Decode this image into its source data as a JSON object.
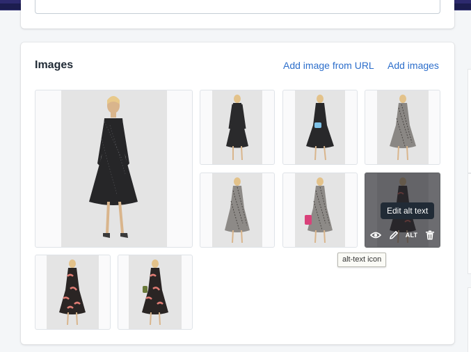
{
  "images_card": {
    "title": "Images",
    "add_from_url": "Add image from URL",
    "add_images": "Add images"
  },
  "gallery": [
    {
      "name": "image-1",
      "dress": "black-polka",
      "featured": true
    },
    {
      "name": "image-2",
      "dress": "black-polka-back"
    },
    {
      "name": "image-3",
      "dress": "black-polka-bag"
    },
    {
      "name": "image-4",
      "dress": "grey-floral"
    },
    {
      "name": "image-5",
      "dress": "grey-floral-back"
    },
    {
      "name": "image-6",
      "dress": "grey-floral-pink-bag"
    },
    {
      "name": "image-7",
      "dress": "dark-floral",
      "hovered": true
    },
    {
      "name": "image-8",
      "dress": "pink-floral"
    },
    {
      "name": "image-9",
      "dress": "pink-floral-green-bag"
    }
  ],
  "hover_tools": {
    "preview_icon": "eye-icon",
    "edit_icon": "pencil-icon",
    "alt_label": "ALT",
    "delete_icon": "trash-icon"
  },
  "tooltip": "Edit alt text",
  "browser_tooltip": "alt-text icon",
  "colors": {
    "topbar": "#1c1d4f",
    "link": "#2c6ecb",
    "page_bg": "#f4f6f8"
  }
}
